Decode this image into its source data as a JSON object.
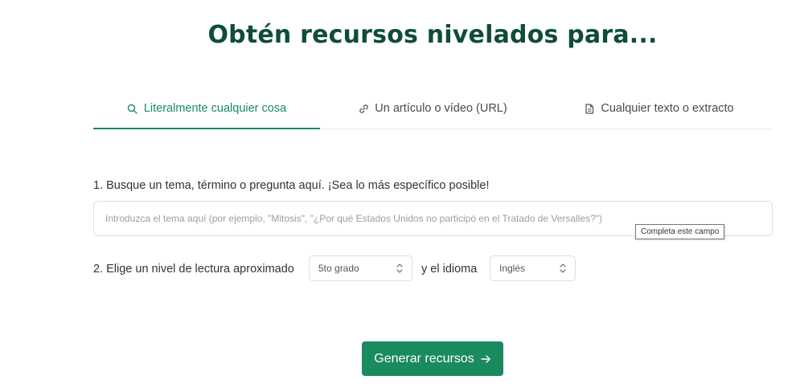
{
  "title": "Obtén recursos nivelados para...",
  "tabs": [
    {
      "label": "Literalmente cualquier cosa",
      "icon": "search-icon",
      "active": true
    },
    {
      "label": "Un artículo o vídeo (URL)",
      "icon": "link-icon",
      "active": false
    },
    {
      "label": "Cualquier texto o extracto",
      "icon": "document-icon",
      "active": false
    }
  ],
  "question1": {
    "label": "1. Busque un tema, término o pregunta aquí. ¡Sea lo más específico posible!",
    "placeholder": "Introduzca el tema aquí (por ejemplo, \"Mitosis\", \"¿Por qué Estados Unidos no participó en el Tratado de Versalles?\")",
    "value": "",
    "tooltip": "Completa este campo"
  },
  "question2": {
    "label": "2. Elige un nivel de lectura aproximado",
    "grade_value": "5to grado",
    "language_label": "y el idioma",
    "language_value": "Inglés"
  },
  "generate_button": {
    "label": "Generar recursos",
    "icon": "arrow-right-icon"
  },
  "colors": {
    "title": "#0f4c3a",
    "accent": "#1a8a5f"
  }
}
